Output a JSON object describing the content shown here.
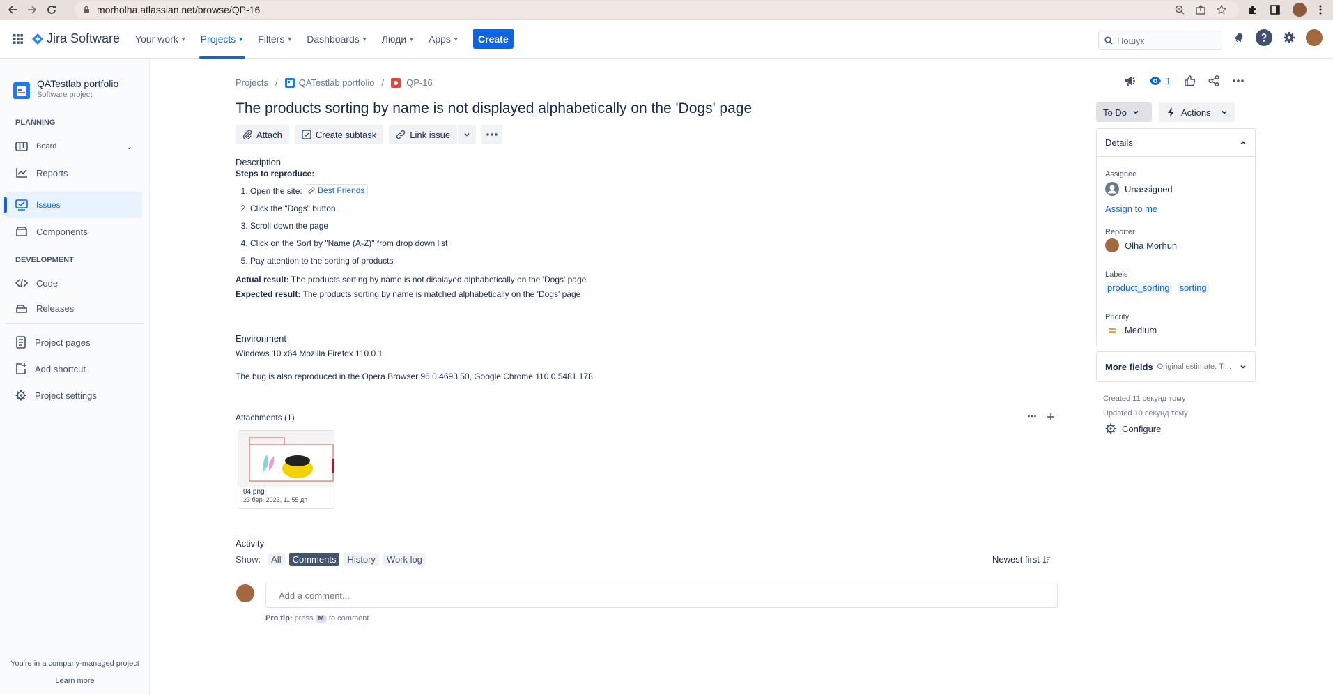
{
  "browser": {
    "url": "morholha.atlassian.net/browse/QP-16"
  },
  "topnav": {
    "product": "Jira Software",
    "items": [
      {
        "label": "Your work"
      },
      {
        "label": "Projects"
      },
      {
        "label": "Filters"
      },
      {
        "label": "Dashboards"
      },
      {
        "label": "Люди"
      },
      {
        "label": "Apps"
      }
    ],
    "create_label": "Create",
    "search_placeholder": "Пошук",
    "accent": "#0c66e4"
  },
  "sidebar": {
    "project_name": "QATestlab portfolio",
    "project_type": "Software project",
    "planning_label": "PLANNING",
    "development_label": "DEVELOPMENT",
    "items": [
      {
        "label": "Board",
        "icon": "board-icon"
      },
      {
        "label": "Reports",
        "icon": "reports-icon"
      },
      {
        "label": "Issues",
        "icon": "issues-icon"
      },
      {
        "label": "Components",
        "icon": "components-icon"
      },
      {
        "label": "Code",
        "icon": "code-icon"
      },
      {
        "label": "Releases",
        "icon": "releases-icon"
      },
      {
        "label": "Project pages",
        "icon": "pages-icon"
      },
      {
        "label": "Add shortcut",
        "icon": "add-shortcut-icon"
      },
      {
        "label": "Project settings",
        "icon": "gear-icon"
      }
    ],
    "footer_text": "You're in a company-managed project",
    "learn_more": "Learn more"
  },
  "breadcrumb": {
    "projects": "Projects",
    "project": "QATestlab portfolio",
    "issue_key": "QP-16"
  },
  "issue": {
    "title": "The products sorting by name is not displayed alphabetically on the 'Dogs' page",
    "toolbar": {
      "attach": "Attach",
      "create_subtask": "Create subtask",
      "link_issue": "Link issue"
    },
    "description_label": "Description",
    "steps_label": "Steps to reproduce:",
    "steps": [
      {
        "prefix": "Open the site: ",
        "link": "Best Friends"
      },
      {
        "prefix": "Click the \"Dogs\" button",
        "link": ""
      },
      {
        "prefix": "Scroll down the page",
        "link": ""
      },
      {
        "prefix": "Click on the Sort by \"Name (A-Z)\" from drop down list",
        "link": ""
      },
      {
        "prefix": "Pay attention to the sorting of products",
        "link": ""
      }
    ],
    "actual_label": "Actual result:",
    "actual_text": " The products sorting by name is not displayed alphabetically on the 'Dogs' page",
    "expected_label": "Expected result:",
    "expected_text": " The products sorting by name is matched alphabetically on the 'Dogs' page",
    "environment_label": "Environment",
    "environment_line1": "Windows 10 x64 Mozilla Firefox 110.0.1",
    "environment_line2": "The bug is also reproduced in the Opera Browser 96.0.4693.50, Google Chrome 110.0.5481.178",
    "attachments_label": "Attachments (1)",
    "attachment": {
      "name": "04.png",
      "date": "23 бер. 2023, 11:55 дп"
    }
  },
  "activity": {
    "label": "Activity",
    "show_label": "Show:",
    "filters": [
      "All",
      "Comments",
      "History",
      "Work log"
    ],
    "sort_label": "Newest first",
    "comment_placeholder": "Add a comment...",
    "pro_tip_label": "Pro tip:",
    "pro_tip_press": "press",
    "pro_tip_key": "M",
    "pro_tip_rest": "to comment"
  },
  "right_panel": {
    "watchers_count": "1",
    "status": "To Do",
    "actions": "Actions",
    "details_label": "Details",
    "assignee_label": "Assignee",
    "assignee_value": "Unassigned",
    "assign_to_me": "Assign to me",
    "reporter_label": "Reporter",
    "reporter_value": "Olha Morhun",
    "labels_label": "Labels",
    "labels": [
      "product_sorting",
      "sorting"
    ],
    "priority_label": "Priority",
    "priority_value": "Medium",
    "more_fields": "More fields",
    "more_fields_hint": "Original estimate, Ti...",
    "created": "Created 11 секунд тому",
    "updated": "Updated 10 секунд тому",
    "configure": "Configure"
  }
}
